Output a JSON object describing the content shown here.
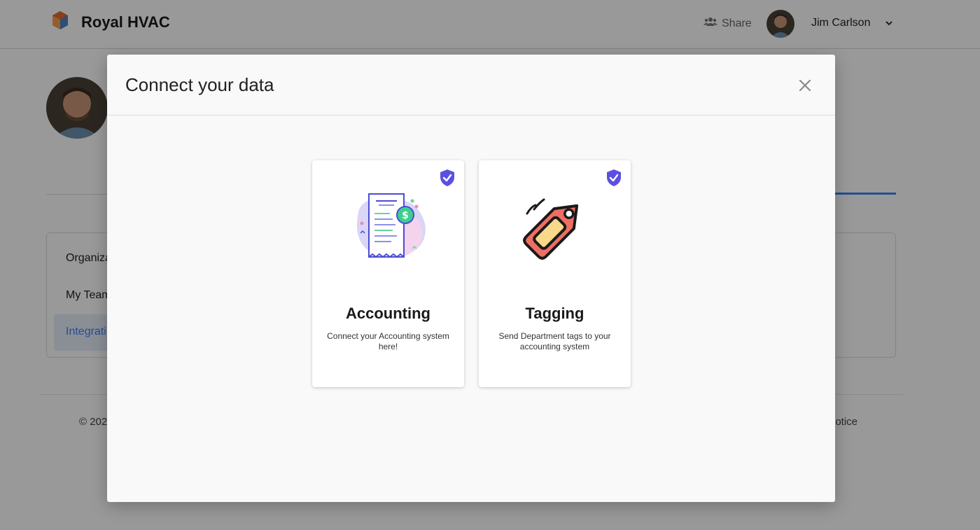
{
  "app": {
    "brand_name": "Royal HVAC",
    "share_label": "Share",
    "user_name": "Jim Carlson"
  },
  "sidebar": {
    "items": [
      {
        "label": "Organiza"
      },
      {
        "label": "My Team"
      },
      {
        "label": "Integrati"
      }
    ]
  },
  "footer": {
    "left_text": "© 202",
    "right_text": "notice"
  },
  "modal": {
    "title": "Connect your data",
    "cards": [
      {
        "title": "Accounting",
        "description": "Connect your Accounting system here!",
        "icon": "receipt-icon",
        "connected": true
      },
      {
        "title": "Tagging",
        "description": "Send Department tags to your accounting system",
        "icon": "tag-icon",
        "connected": true
      }
    ]
  },
  "colors": {
    "accent": "#3b82f6",
    "badge": "#5b4fe3",
    "tag_red": "#ef6e64",
    "tag_yellow": "#f8d98a"
  }
}
